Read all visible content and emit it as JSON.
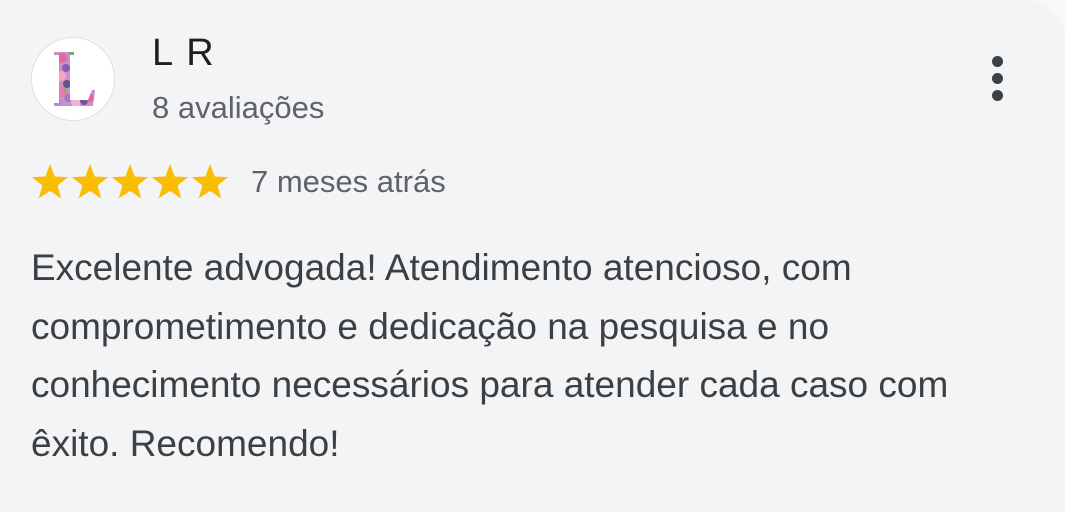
{
  "review": {
    "author": "L R",
    "review_count": "8 avaliações",
    "rating": 5,
    "rating_max": 5,
    "date": "7 meses atrás",
    "text": "Excelente advogada! Atendimento atencioso, com comprometimento e dedicação na pesquisa e no conhecimento necessários para atender cada caso com êxito. Recomendo!"
  },
  "avatar": {
    "initial": "L",
    "icon": "floral-letter-avatar"
  },
  "actions": {
    "more_icon": "more-vert-icon"
  },
  "colors": {
    "star": "#fbbc04",
    "text": "#3c4043",
    "secondary_text": "#5f6368",
    "background": "#f3f4f6"
  }
}
